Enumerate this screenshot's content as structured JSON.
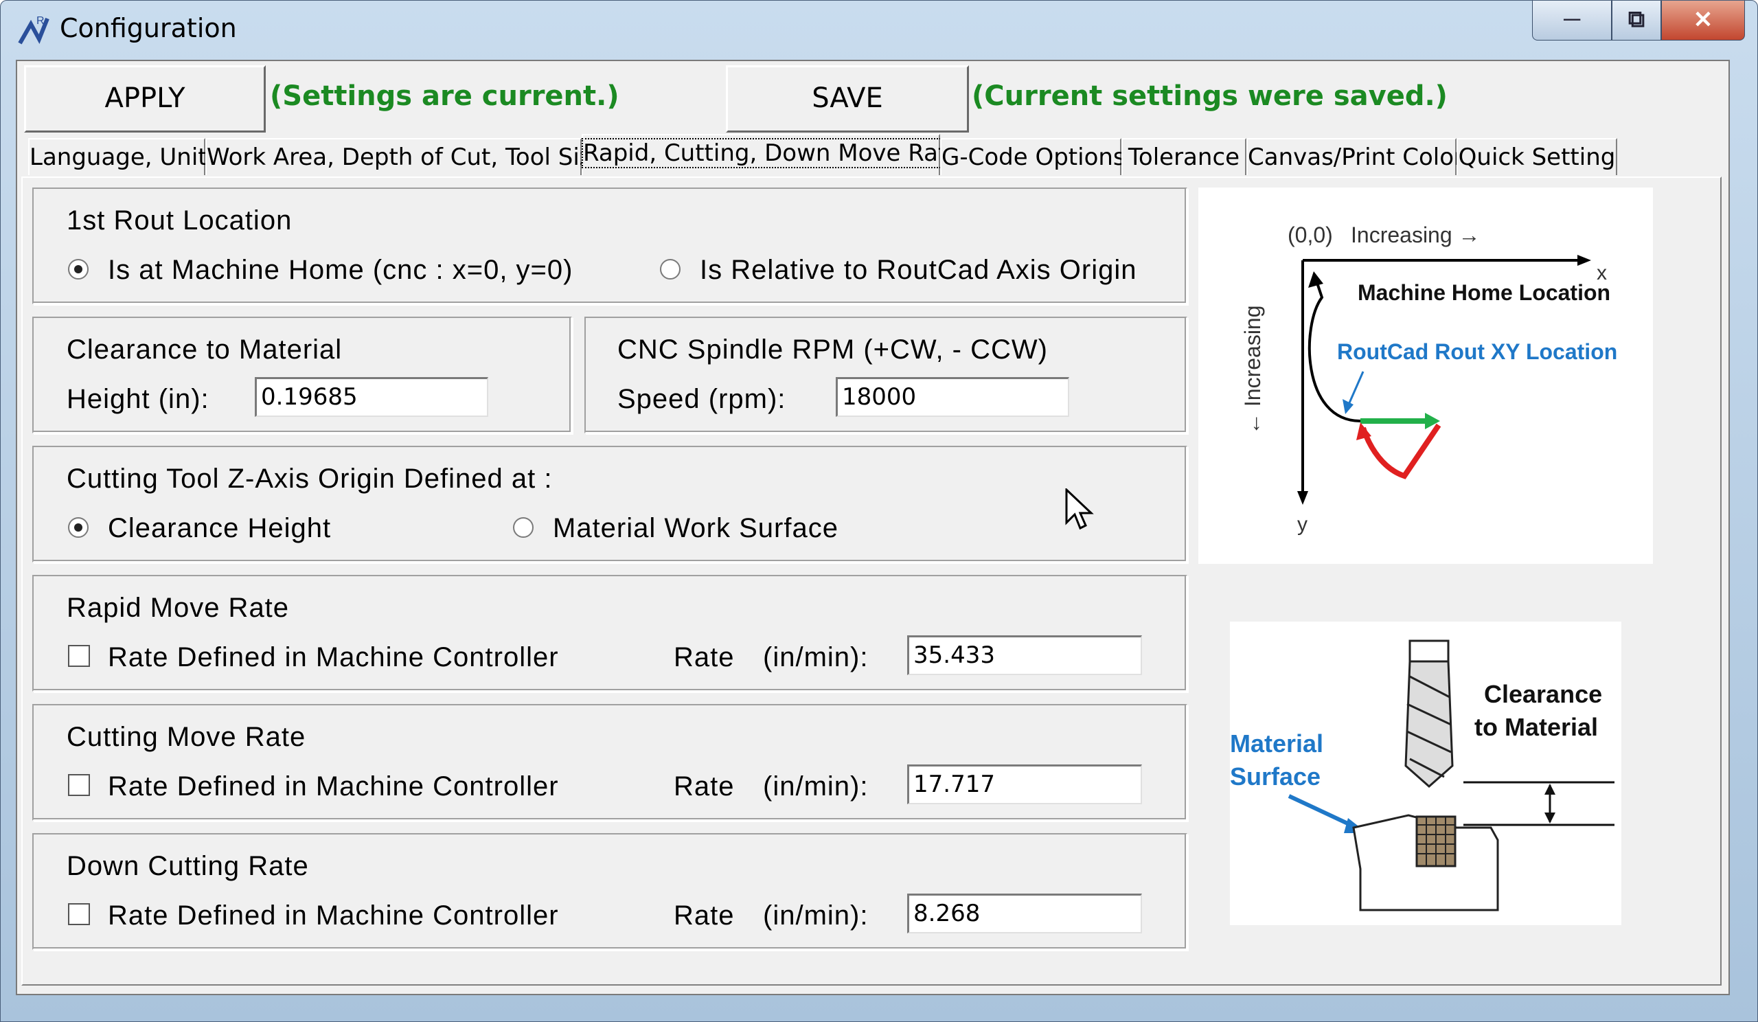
{
  "window": {
    "title": "Configuration"
  },
  "toolbar": {
    "apply_label": "APPLY",
    "apply_status": "(Settings are current.)",
    "save_label": "SAVE",
    "save_status": "(Current settings were saved.)"
  },
  "tabs": [
    {
      "label": "Language, Unit"
    },
    {
      "label": "Work Area, Depth of Cut, Tool Size"
    },
    {
      "label": "Rapid, Cutting, Down Move Rate"
    },
    {
      "label": "G-Code Options"
    },
    {
      "label": "Tolerance"
    },
    {
      "label": "Canvas/Print Color"
    },
    {
      "label": "Quick Setting"
    }
  ],
  "active_tab": "Rapid, Cutting, Down Move Rate",
  "rout_location": {
    "title": "1st Rout Location",
    "option1": "Is at Machine Home (cnc : x=0, y=0)",
    "option2": "Is Relative to RoutCad Axis Origin",
    "selected": "option1"
  },
  "clearance": {
    "title": "Clearance to Material",
    "height_label": "Height  (in):",
    "height_value": "0.19685"
  },
  "spindle": {
    "title": "CNC Spindle RPM (+CW, - CCW)",
    "speed_label": "Speed  (rpm):",
    "speed_value": "18000"
  },
  "z_origin": {
    "title": "Cutting Tool Z-Axis Origin Defined at :",
    "option1": "Clearance Height",
    "option2": "Material Work Surface",
    "selected": "option1"
  },
  "rapid": {
    "title": "Rapid Move Rate",
    "checkbox_label": "Rate Defined in Machine Controller",
    "checked": false,
    "rate_label": "Rate",
    "unit_label": "(in/min):",
    "value": "35.433"
  },
  "cutting": {
    "title": "Cutting Move Rate",
    "checkbox_label": "Rate Defined in Machine Controller",
    "checked": false,
    "rate_label": "Rate",
    "unit_label": "(in/min):",
    "value": "17.717"
  },
  "down": {
    "title": "Down Cutting Rate",
    "checkbox_label": "Rate Defined in Machine Controller",
    "checked": false,
    "rate_label": "Rate",
    "unit_label": "(in/min):",
    "value": "8.268"
  },
  "axis_diagram": {
    "origin": "(0,0)",
    "increasing_x": "Increasing →",
    "x_label": "x",
    "y_label": "y",
    "increasing_y": "← Increasing",
    "home_label": "Machine Home Location",
    "rout_label": "RoutCad Rout XY Location"
  },
  "tool_diagram": {
    "clearance_line1": "Clearance",
    "clearance_line2": "to Material",
    "surface_line1": "Material",
    "surface_line2": "Surface"
  },
  "colors": {
    "status_green": "#1b8a22",
    "diagram_blue": "#1f78c8",
    "diagram_green": "#22b04a",
    "diagram_red": "#e02020"
  }
}
